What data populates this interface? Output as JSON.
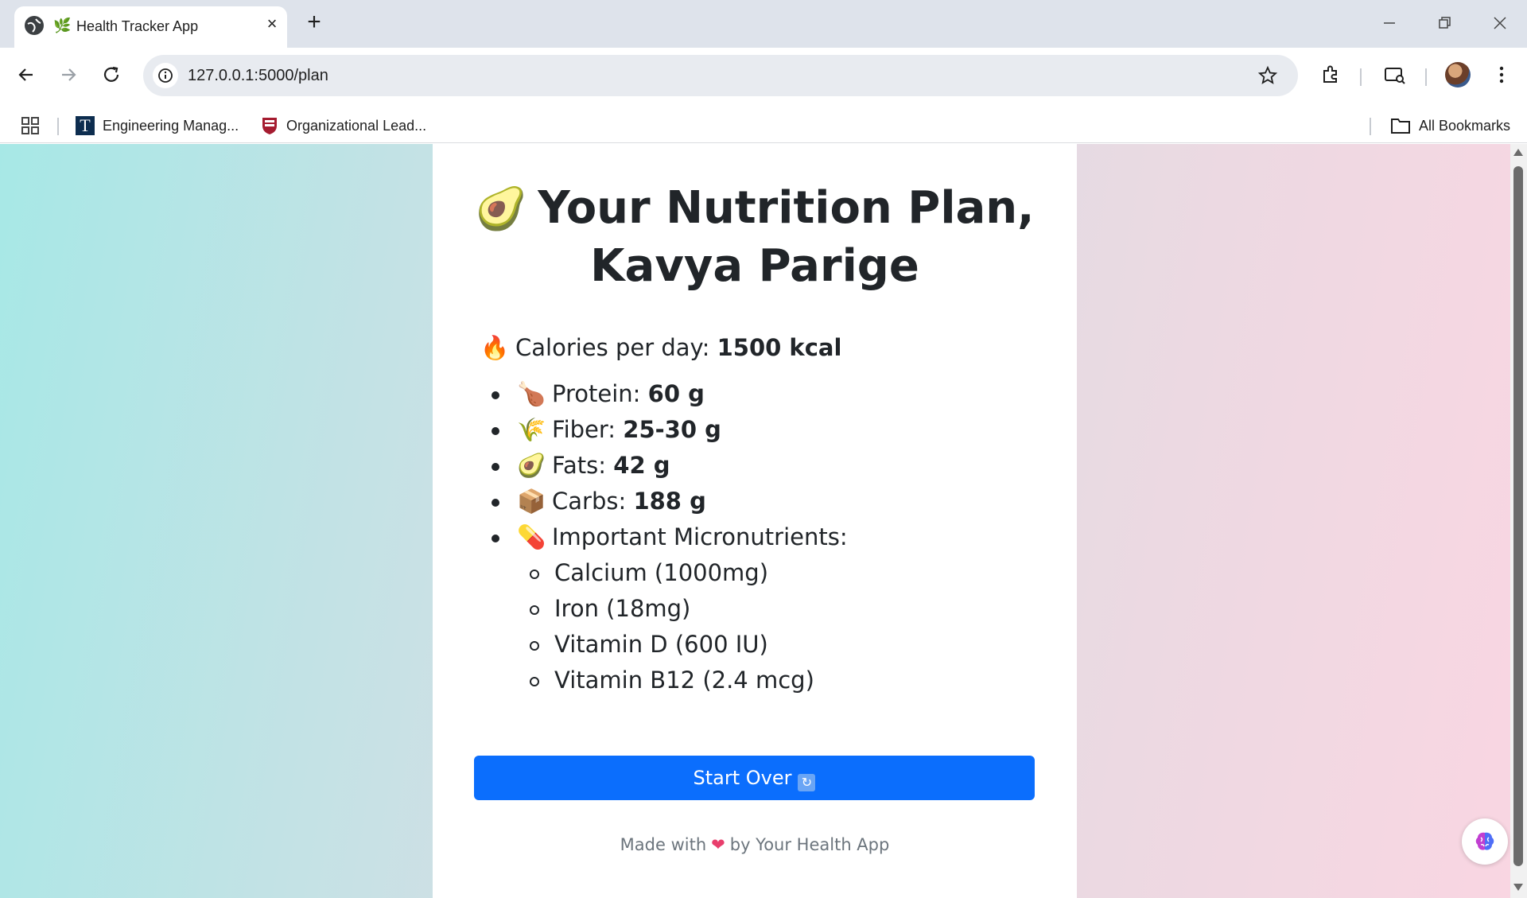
{
  "browser": {
    "tab_title": "Health Tracker App",
    "tab_favicon": "🌿",
    "url": "127.0.0.1:5000/plan",
    "bookmarks": [
      {
        "label": "Engineering Manag...",
        "icon": "T"
      },
      {
        "label": "Organizational Lead...",
        "icon": "shield-icon"
      }
    ],
    "all_bookmarks": "All Bookmarks"
  },
  "page": {
    "title_emoji": "🥑",
    "title": "Your Nutrition Plan, Kavya Parige",
    "calories": {
      "emoji": "🔥",
      "label": "Calories per day:",
      "value": "1500 kcal"
    },
    "nutrients": [
      {
        "emoji": "🍗",
        "label": "Protein:",
        "value": "60 g"
      },
      {
        "emoji": "🌾",
        "label": "Fiber:",
        "value": "25-30 g"
      },
      {
        "emoji": "🥑",
        "label": "Fats:",
        "value": "42 g"
      },
      {
        "emoji": "📦",
        "label": "Carbs:",
        "value": "188 g"
      },
      {
        "emoji": "💊",
        "label": "Important Micronutrients:",
        "value": ""
      }
    ],
    "micronutrients": [
      "Calcium (1000mg)",
      "Iron (18mg)",
      "Vitamin D (600 IU)",
      "Vitamin B12 (2.4 mcg)"
    ],
    "button": {
      "label": "Start Over",
      "icon": "🔄"
    },
    "footer": {
      "before": "Made with",
      "heart": "❤",
      "after": "by Your Health App"
    }
  },
  "colors": {
    "accent": "#0b6efd",
    "text": "#212529",
    "muted": "#6c757d"
  }
}
